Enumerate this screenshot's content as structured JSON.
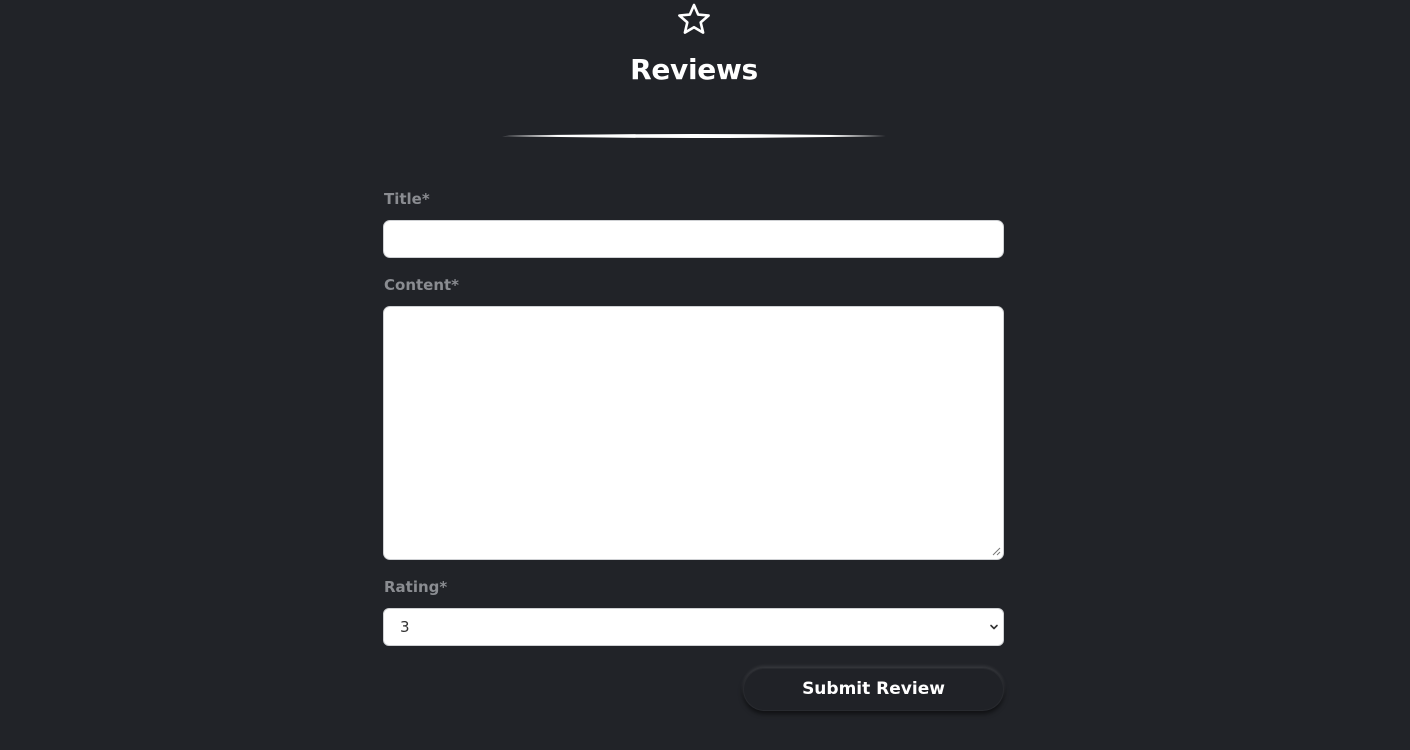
{
  "header": {
    "icon": "star-icon",
    "title": "Reviews"
  },
  "form": {
    "title_label": "Title*",
    "title_value": "",
    "content_label": "Content*",
    "content_value": "",
    "rating_label": "Rating*",
    "rating_value": "3",
    "submit_label": "Submit Review"
  },
  "colors": {
    "background": "#212328",
    "label": "#8a8c91",
    "text": "#ffffff",
    "input_bg": "#ffffff"
  }
}
